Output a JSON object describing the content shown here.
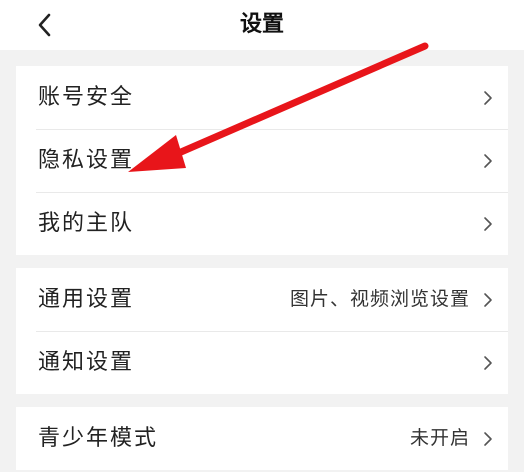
{
  "header": {
    "title": "设置",
    "back_icon": "chevron-left-icon"
  },
  "groups": [
    {
      "items": [
        {
          "label": "账号安全",
          "icon": "chevron-right-icon"
        },
        {
          "label": "隐私设置",
          "icon": "chevron-right-icon"
        },
        {
          "label": "我的主队",
          "icon": "chevron-right-icon"
        }
      ]
    },
    {
      "items": [
        {
          "label": "通用设置",
          "value": "图片、视频浏览设置",
          "icon": "chevron-right-icon"
        },
        {
          "label": "通知设置",
          "icon": "chevron-right-icon"
        }
      ]
    },
    {
      "items": [
        {
          "label": "青少年模式",
          "value": "未开启",
          "icon": "chevron-right-icon"
        }
      ]
    }
  ],
  "annotation": {
    "type": "red-arrow",
    "color": "#e8151a",
    "points_to": "隐私设置"
  },
  "colors": {
    "background": "#f2f2f2",
    "card": "#ffffff",
    "divider": "#e9e9e9"
  }
}
